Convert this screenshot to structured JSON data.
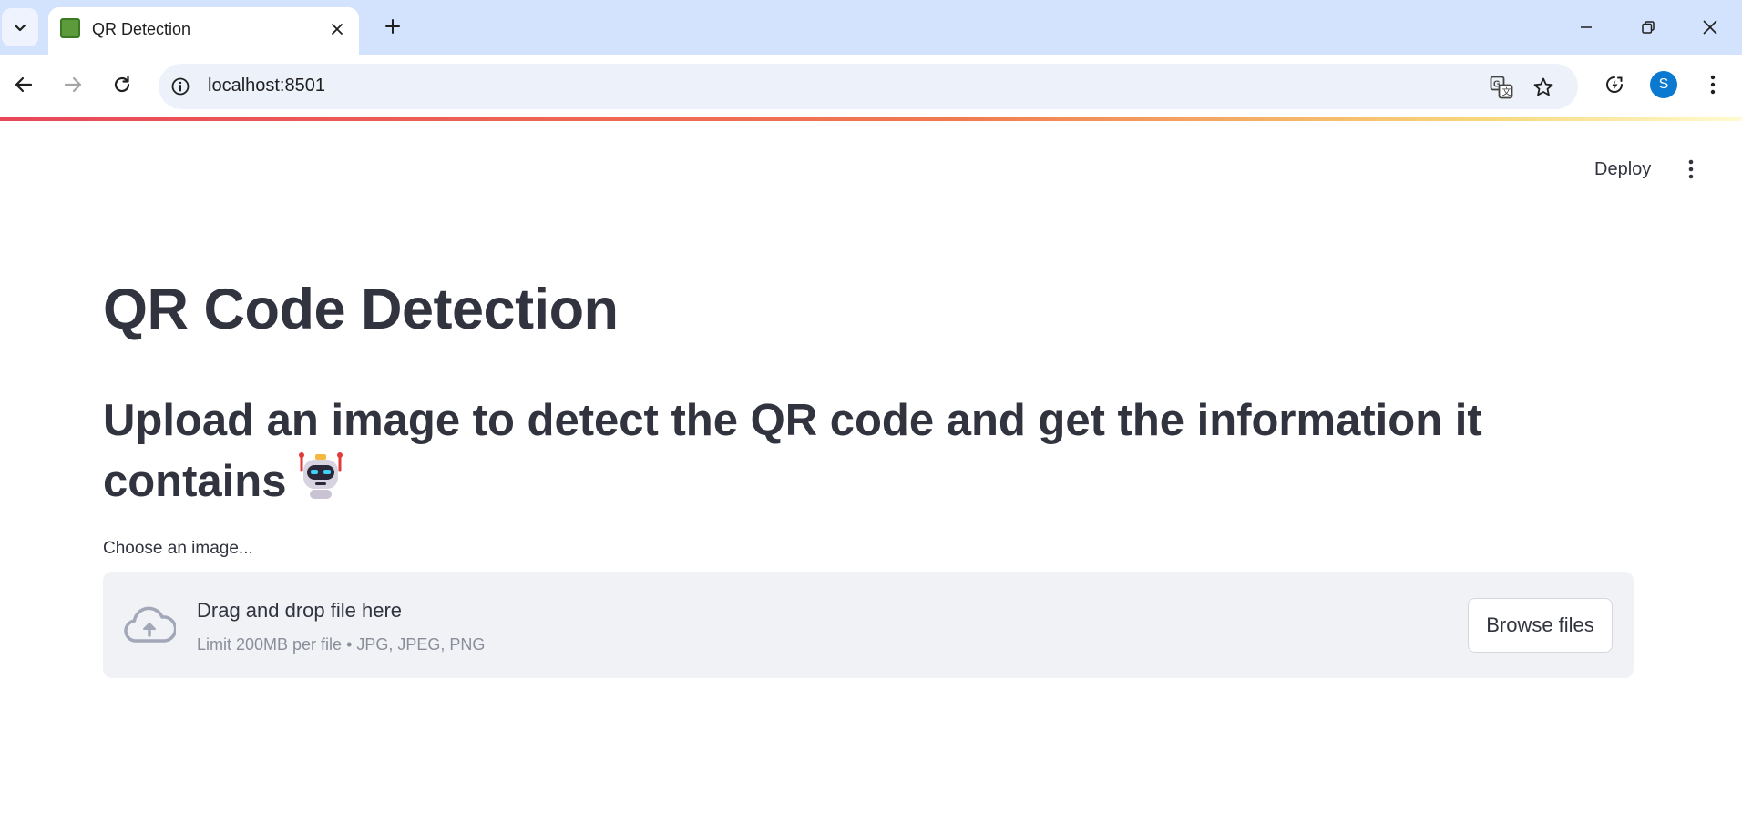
{
  "browser": {
    "tab": {
      "title": "QR Detection"
    },
    "omnibox": {
      "url": "localhost:8501"
    },
    "profile_initial": "S"
  },
  "app": {
    "deploy_label": "Deploy",
    "title": "QR Code Detection",
    "subtitle": "Upload an image to detect the QR code and get the information it contains",
    "subtitle_emoji": "robot-emoji",
    "uploader": {
      "label": "Choose an image...",
      "dropzone_title": "Drag and drop file here",
      "limit_text": "Limit 200MB per file • JPG, JPEG, PNG",
      "browse_label": "Browse files"
    }
  },
  "colors": {
    "tabstrip": "#d3e3fd",
    "text": "#31333f",
    "dropzone_bg": "#f0f2f6",
    "avatar": "#0b79d0"
  },
  "icons": [
    "tab-search-icon",
    "favicon-book-icon",
    "close-icon",
    "plus-icon",
    "minimize-icon",
    "restore-icon",
    "window-close-icon",
    "back-icon",
    "forward-icon",
    "reload-icon",
    "site-info-icon",
    "translate-icon",
    "star-icon",
    "performance-icon",
    "kebab-menu-icon",
    "cloud-upload-icon"
  ]
}
